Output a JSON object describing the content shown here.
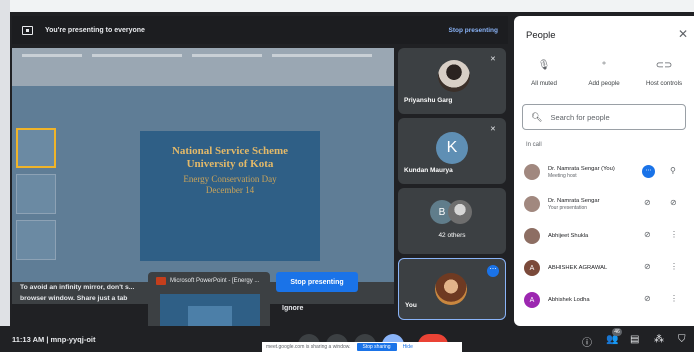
{
  "banner": {
    "message": "You're presenting to everyone",
    "stop_link": "Stop presenting"
  },
  "slide": {
    "line1": "National Service Scheme",
    "line2": "University of Kota",
    "line3": "Energy Conservation Day",
    "line4": "December 14"
  },
  "warning": {
    "text": "To avoid an infinity mirror, don't s... browser window. Share just a tab"
  },
  "preview": {
    "title": "Microsoft PowerPoint - [Energy ..."
  },
  "buttons": {
    "stop_presenting": "Stop presenting",
    "ignore": "Ignore"
  },
  "tiles": [
    {
      "name": "Priyanshu Garg"
    },
    {
      "name": "Kundan Maurya",
      "initial": "K"
    },
    {
      "initial": "B",
      "others_label": "42 others"
    },
    {
      "name": "You"
    }
  ],
  "bottom": {
    "time_code": "11:13 AM  |  mnp-yyqj-oit",
    "share_notice": "meet.google.com is sharing a window.",
    "stop_sharing": "Stop sharing",
    "hide": "Hide",
    "people_badge": "46"
  },
  "people_panel": {
    "title": "People",
    "actions": [
      {
        "label": "All muted",
        "icon": "mic-off-icon"
      },
      {
        "label": "Add people",
        "icon": "add-person-icon"
      },
      {
        "label": "Host controls",
        "icon": "toggle-icon"
      }
    ],
    "search_placeholder": "Search for people",
    "section_label": "In call",
    "participants": [
      {
        "name": "Dr. Namrata Sengar (You)",
        "role": "Meeting host",
        "avatar_color": "#a1887f"
      },
      {
        "name": "Dr. Namrata Sengar",
        "role": "Your presentation",
        "avatar_color": "#a1887f"
      },
      {
        "name": "Abhijeet Shukla",
        "role": "",
        "avatar_color": "#8d6e63"
      },
      {
        "name": "ABHISHEK AGRAWAL",
        "role": "",
        "initial": "A",
        "avatar_color": "#7b4a3a"
      },
      {
        "name": "Abhishek Lodha",
        "role": "",
        "initial": "A",
        "avatar_color": "#9c27b0"
      }
    ]
  }
}
